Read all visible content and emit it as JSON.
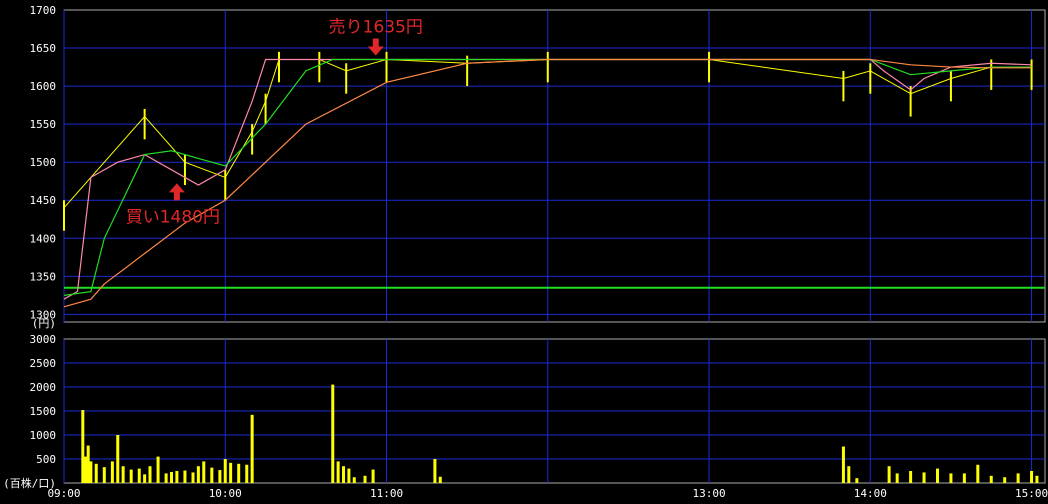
{
  "chart_data": [
    {
      "type": "candlestick-line",
      "panel": "price",
      "unit_label": "(円)",
      "ylim": [
        1290,
        1700
      ],
      "yticks": [
        1300,
        1350,
        1400,
        1450,
        1500,
        1550,
        1600,
        1650,
        1700
      ],
      "xlim_minutes": [
        540,
        905
      ],
      "grid": true,
      "reference_line": {
        "value": 1335,
        "color": "#22dd22"
      },
      "series": [
        {
          "color": "#ffff00",
          "style": "tick-bars",
          "x": [
            "09:00",
            "09:30",
            "09:45",
            "10:00",
            "10:10",
            "10:15",
            "10:20",
            "10:35",
            "10:45",
            "11:00",
            "11:30",
            "12:00",
            "13:00",
            "13:50",
            "14:00",
            "14:15",
            "14:30",
            "14:45",
            "15:00"
          ],
          "values": [
            1440,
            1560,
            1500,
            1480,
            1540,
            1580,
            1635,
            1635,
            1620,
            1635,
            1630,
            1635,
            1635,
            1610,
            1620,
            1590,
            1610,
            1625,
            1625
          ]
        },
        {
          "color": "#ff88aa",
          "x": [
            "09:00",
            "09:05",
            "09:10",
            "09:20",
            "09:30",
            "09:40",
            "09:50",
            "10:00",
            "10:10",
            "10:15",
            "10:20",
            "11:00",
            "12:00",
            "13:00",
            "13:50",
            "14:00",
            "14:05",
            "14:15",
            "14:20",
            "14:30",
            "14:45",
            "15:00"
          ],
          "values": [
            1320,
            1330,
            1480,
            1500,
            1510,
            1490,
            1470,
            1490,
            1580,
            1635,
            1635,
            1635,
            1635,
            1635,
            1635,
            1635,
            1620,
            1595,
            1610,
            1625,
            1630,
            1628
          ]
        },
        {
          "color": "#22dd22",
          "x": [
            "09:00",
            "09:10",
            "09:15",
            "09:30",
            "09:40",
            "09:50",
            "10:00",
            "10:15",
            "10:30",
            "10:40",
            "11:00",
            "12:00",
            "13:00",
            "13:50",
            "14:00",
            "14:15",
            "14:30",
            "14:45",
            "15:00"
          ],
          "values": [
            1325,
            1330,
            1400,
            1510,
            1515,
            1505,
            1495,
            1550,
            1620,
            1635,
            1635,
            1635,
            1635,
            1635,
            1635,
            1615,
            1620,
            1625,
            1625
          ]
        },
        {
          "color": "#ff8844",
          "x": [
            "09:00",
            "09:10",
            "09:15",
            "09:30",
            "09:45",
            "10:00",
            "10:15",
            "10:30",
            "11:00",
            "11:30",
            "12:00",
            "13:00",
            "13:50",
            "14:00",
            "14:15",
            "14:30",
            "14:45",
            "15:00"
          ],
          "values": [
            1310,
            1320,
            1340,
            1380,
            1420,
            1450,
            1500,
            1550,
            1605,
            1630,
            1635,
            1635,
            1635,
            1635,
            1628,
            1625,
            1624,
            1624
          ]
        }
      ],
      "annotations": [
        {
          "text": "買い1480円",
          "arrow": "up",
          "x": "09:42",
          "value": 1480
        },
        {
          "text": "売り1635円",
          "arrow": "down",
          "x": "10:56",
          "value": 1635
        }
      ]
    },
    {
      "type": "bar",
      "panel": "volume",
      "unit_label": "(百株/口)",
      "ylim": [
        0,
        3000
      ],
      "yticks": [
        500,
        1000,
        1500,
        2000,
        2500,
        3000
      ],
      "grid": true,
      "color": "#ffff00",
      "x": [
        "09:07",
        "09:08",
        "09:09",
        "09:10",
        "09:12",
        "09:15",
        "09:18",
        "09:20",
        "09:22",
        "09:25",
        "09:28",
        "09:30",
        "09:32",
        "09:35",
        "09:38",
        "09:40",
        "09:42",
        "09:45",
        "09:48",
        "09:50",
        "09:52",
        "09:55",
        "09:58",
        "10:00",
        "10:02",
        "10:05",
        "10:08",
        "10:10",
        "10:40",
        "10:42",
        "10:44",
        "10:46",
        "10:48",
        "10:52",
        "10:55",
        "11:18",
        "11:20",
        "13:50",
        "13:52",
        "13:55",
        "14:07",
        "14:10",
        "14:15",
        "14:20",
        "14:25",
        "14:30",
        "14:35",
        "14:40",
        "14:45",
        "14:50",
        "14:55",
        "15:00",
        "15:02"
      ],
      "values": [
        1520,
        550,
        780,
        450,
        400,
        330,
        450,
        1000,
        350,
        280,
        300,
        180,
        350,
        550,
        200,
        230,
        250,
        260,
        220,
        350,
        450,
        320,
        270,
        500,
        420,
        400,
        380,
        1420,
        2050,
        450,
        350,
        300,
        120,
        150,
        280,
        500,
        130,
        760,
        350,
        100,
        350,
        200,
        250,
        220,
        300,
        200,
        200,
        380,
        150,
        120,
        200,
        250,
        150
      ]
    }
  ],
  "x_axis": {
    "ticks": [
      "09:00",
      "10:00",
      "11:00",
      "12:00",
      "13:00",
      "14:00",
      "15:00"
    ],
    "tick_labels": [
      "09:00",
      "10:00",
      "11:00",
      "",
      "13:00",
      "14:00",
      "15:00"
    ]
  }
}
